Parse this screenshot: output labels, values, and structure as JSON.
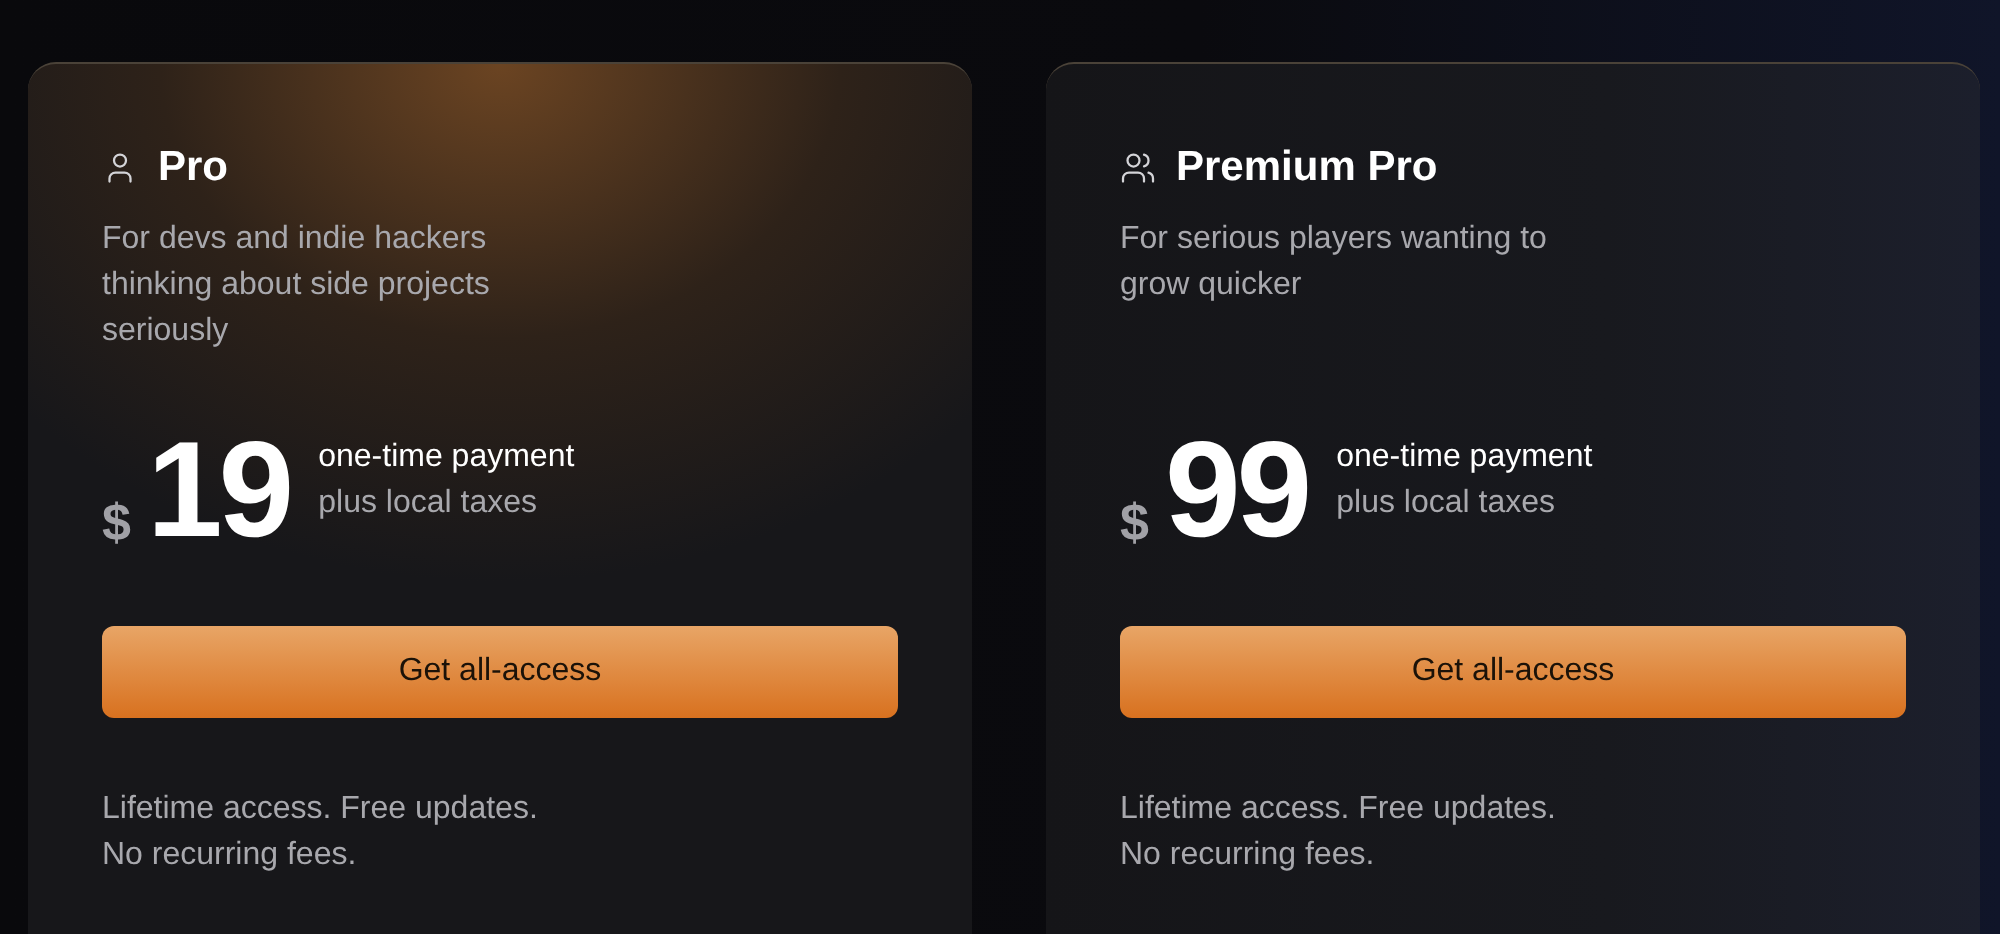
{
  "plans": [
    {
      "kind": "single",
      "name": "Pro",
      "description": "For devs and indie hackers thinking about side projects seriously",
      "currency": "$",
      "price": "19",
      "payment_note": "one-time payment",
      "tax_note": "plus local taxes",
      "button": "Get all-access",
      "footer": [
        "Lifetime access. Free updates.",
        "No recurring fees."
      ],
      "highlighted": true
    },
    {
      "kind": "team",
      "name": "Premium Pro",
      "description": "For serious players wanting to grow quicker",
      "currency": "$",
      "price": "99",
      "payment_note": "one-time payment",
      "tax_note": "plus local taxes",
      "button": "Get all-access",
      "footer": [
        "Lifetime access. Free updates.",
        "No recurring fees."
      ],
      "highlighted": false
    }
  ]
}
